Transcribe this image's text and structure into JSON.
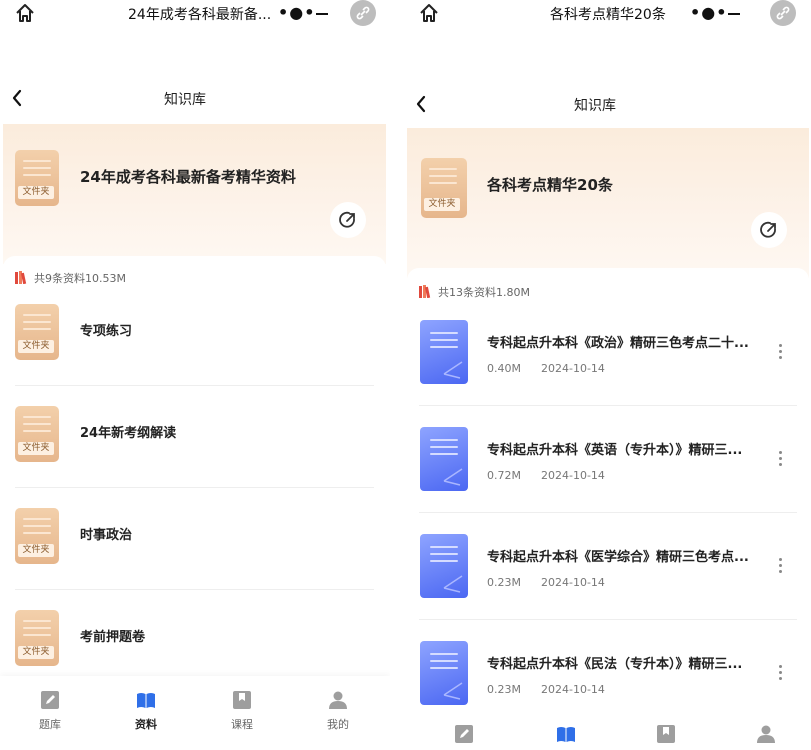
{
  "left": {
    "capsule_title": "24年成考各科最新备...",
    "nav_title": "知识库",
    "hero_title": "24年成考各科最新备考精华资料",
    "folder_tag": "文件夹",
    "count_text": "共9条资料10.53M",
    "folders": [
      {
        "name": "专项练习"
      },
      {
        "name": "24年新考纲解读"
      },
      {
        "name": "时事政治"
      },
      {
        "name": "考前押题卷"
      }
    ],
    "tabs": [
      {
        "label": "题库",
        "icon": "pencil-icon"
      },
      {
        "label": "资料",
        "icon": "book-icon",
        "active": true
      },
      {
        "label": "课程",
        "icon": "bookmark-icon"
      },
      {
        "label": "我的",
        "icon": "user-icon"
      }
    ]
  },
  "right": {
    "capsule_title": "各科考点精华20条",
    "nav_title": "知识库",
    "hero_title": "各科考点精华20条",
    "folder_tag": "文件夹",
    "count_text": "共13条资料1.80M",
    "files": [
      {
        "title": "专科起点升本科《政治》精研三色考点二十...",
        "size": "0.40M",
        "date": "2024-10-14"
      },
      {
        "title": "专科起点升本科《英语（专升本）》精研三...",
        "size": "0.72M",
        "date": "2024-10-14"
      },
      {
        "title": "专科起点升本科《医学综合》精研三色考点...",
        "size": "0.23M",
        "date": "2024-10-14"
      },
      {
        "title": "专科起点升本科《民法（专升本）》精研三...",
        "size": "0.23M",
        "date": "2024-10-14"
      }
    ]
  },
  "colors": {
    "hero_gradient": "#fbecdc",
    "folder": "#e6b68c",
    "doc_icon": "#4b67f2",
    "active_tab": "#2f6fe8",
    "books_icon": "#e0493d"
  }
}
